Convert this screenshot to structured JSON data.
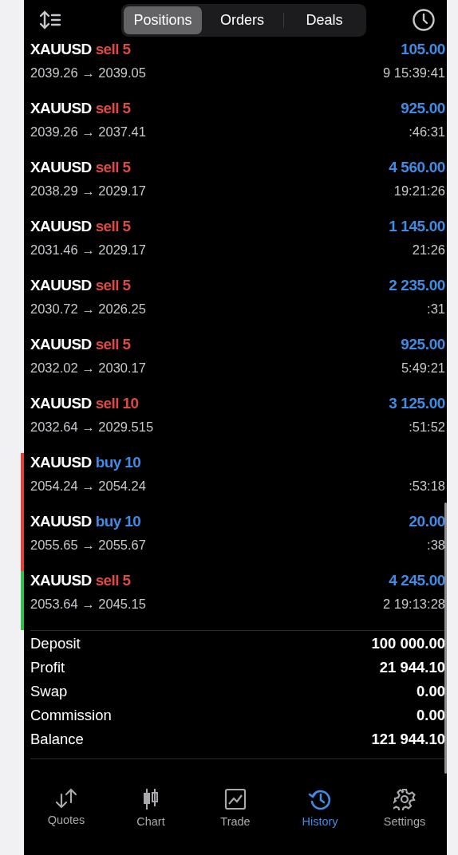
{
  "segments": [
    {
      "label": "Positions",
      "selected": true
    },
    {
      "label": "Orders",
      "selected": false
    },
    {
      "label": "Deals",
      "selected": false
    }
  ],
  "deals": [
    {
      "symbol": "XAUUSD",
      "action": "sell 5",
      "kind": "sell",
      "prices": "2039.26 → 2039.05",
      "profit": "105.00",
      "time": "9 15:39:41"
    },
    {
      "symbol": "XAUUSD",
      "action": "sell 5",
      "kind": "sell",
      "prices": "2039.26 → 2037.41",
      "profit": "925.00",
      "time": ":46:31"
    },
    {
      "symbol": "XAUUSD",
      "action": "sell 5",
      "kind": "sell",
      "prices": "2038.29 → 2029.17",
      "profit": "4 560.00",
      "time": "19:21:26"
    },
    {
      "symbol": "XAUUSD",
      "action": "sell 5",
      "kind": "sell",
      "prices": "2031.46 → 2029.17",
      "profit": "1 145.00",
      "time": "21:26"
    },
    {
      "symbol": "XAUUSD",
      "action": "sell 5",
      "kind": "sell",
      "prices": "2030.72 → 2026.25",
      "profit": "2 235.00",
      "time": ":31"
    },
    {
      "symbol": "XAUUSD",
      "action": "sell 5",
      "kind": "sell",
      "prices": "2032.02 → 2030.17",
      "profit": "925.00",
      "time": "5:49:21"
    },
    {
      "symbol": "XAUUSD",
      "action": "sell 10",
      "kind": "sell",
      "prices": "2032.64 → 2029.515",
      "profit": "3 125.00",
      "time": ":51:52"
    },
    {
      "symbol": "XAUUSD",
      "action": "buy 10",
      "kind": "buy",
      "prices": "2054.24 → 2054.24",
      "time": ":53:18",
      "color": "#d9443f"
    },
    {
      "symbol": "XAUUSD",
      "action": "buy 10",
      "kind": "buy",
      "prices": "2055.65 → 2055.67",
      "profit": "20.00",
      "time": ":38",
      "color": "#d9443f"
    },
    {
      "symbol": "XAUUSD",
      "action": "sell 5",
      "kind": "sell",
      "prices": "2053.64 → 2045.15",
      "profit": "4 245.00",
      "time": "2 19:13:28",
      "color": "#2fbf4a"
    }
  ],
  "summary": [
    {
      "label": "Deposit",
      "value": "100 000.00"
    },
    {
      "label": "Profit",
      "value": "21 944.10"
    },
    {
      "label": "Swap",
      "value": "0.00"
    },
    {
      "label": "Commission",
      "value": "0.00"
    },
    {
      "label": "Balance",
      "value": "121 944.10"
    }
  ],
  "tabs": [
    {
      "label": "Quotes",
      "kind": "quotes",
      "selected": false
    },
    {
      "label": "Chart",
      "kind": "chart",
      "selected": false
    },
    {
      "label": "Trade",
      "kind": "trade",
      "selected": false
    },
    {
      "label": "History",
      "kind": "history",
      "selected": true
    },
    {
      "label": "Settings",
      "kind": "settings",
      "selected": false
    }
  ]
}
